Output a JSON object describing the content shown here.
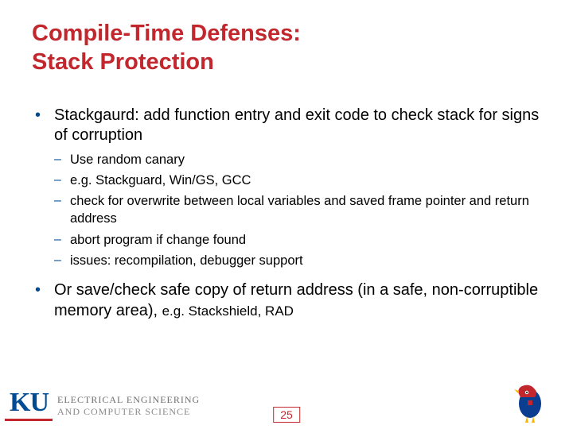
{
  "title_line1": "Compile-Time Defenses:",
  "title_line2": "Stack Protection",
  "bullets": [
    {
      "text": "Stackgaurd: add function entry and exit code to check stack for signs of corruption",
      "sub": [
        "Use random canary",
        "e.g. Stackguard, Win/GS, GCC",
        "check for overwrite between local variables and saved frame pointer and return address",
        "abort program if change found",
        "issues: recompilation, debugger support"
      ]
    },
    {
      "text": "Or save/check safe copy of return address (in a safe, non-corruptible memory area), ",
      "tail": "e.g. Stackshield, RAD"
    }
  ],
  "footer": {
    "ku": "KU",
    "dept_line1": "ELECTRICAL ENGINEERING",
    "dept_line2": "AND COMPUTER SCIENCE",
    "page": "25"
  }
}
